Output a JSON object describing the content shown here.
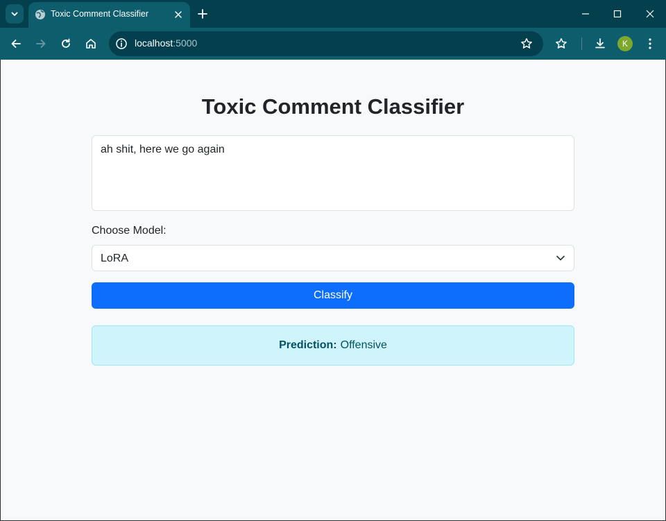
{
  "browser": {
    "tab": {
      "title": "Toxic Comment Classifier"
    },
    "address": {
      "host": "localhost",
      "port": ":5000"
    },
    "profile_initial": "K"
  },
  "page": {
    "title": "Toxic Comment Classifier",
    "comment_value": "ah shit, here we go again",
    "model_label": "Choose Model:",
    "selected_model": "LoRA",
    "classify_label": "Classify",
    "result": {
      "label": "Prediction:",
      "value": "Offensive"
    }
  },
  "colors": {
    "chrome_dark": "#033f4d",
    "chrome_toolbar": "#0d5d6c",
    "primary_button": "#0d6efd",
    "alert_bg": "#cff4fc",
    "alert_text": "#055160"
  },
  "icons": [
    "tab-search-icon",
    "globe-icon",
    "close-icon",
    "plus-icon",
    "minimize-icon",
    "maximize-icon",
    "back-icon",
    "forward-icon",
    "reload-icon",
    "home-icon",
    "site-info-icon",
    "bookmark-star-icon",
    "bookmarks-icon",
    "download-icon",
    "menu-icon",
    "chevron-down-icon"
  ]
}
